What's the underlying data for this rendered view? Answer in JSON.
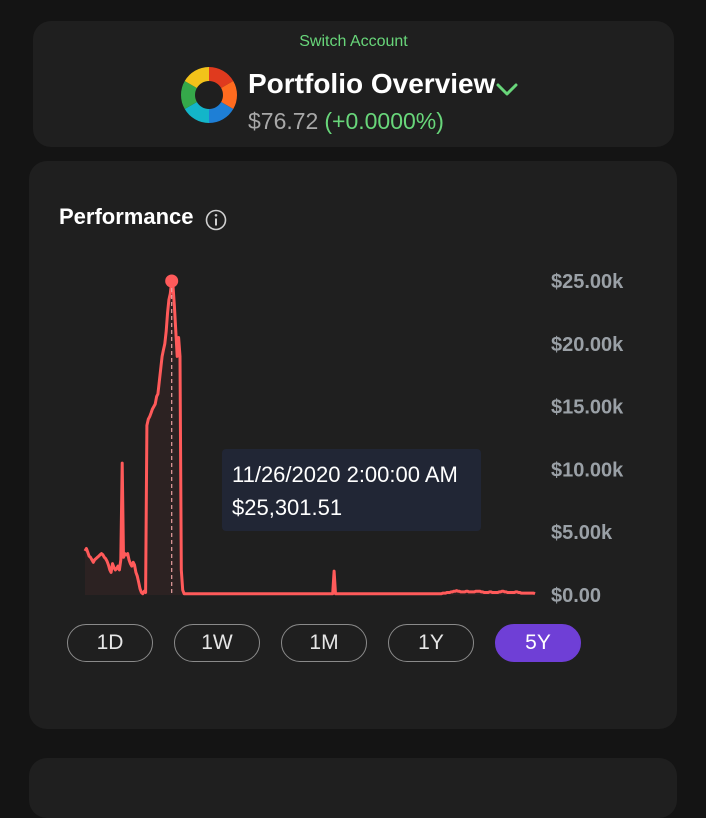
{
  "account": {
    "switch_label": "Switch Account",
    "title": "Portfolio Overview",
    "value": "$76.72",
    "change": "(+0.0000%)"
  },
  "performance": {
    "title": "Performance",
    "tooltip": {
      "date": "11/26/2020 2:00:00 AM",
      "value": "$25,301.51"
    },
    "ranges": [
      {
        "label": "1D",
        "active": false
      },
      {
        "label": "1W",
        "active": false
      },
      {
        "label": "1M",
        "active": false
      },
      {
        "label": "1Y",
        "active": false
      },
      {
        "label": "5Y",
        "active": true
      }
    ]
  },
  "chart_data": {
    "type": "line",
    "ylim": [
      0,
      25000
    ],
    "y_ticks": [
      "$0.00",
      "$5.00k",
      "$10.00k",
      "$15.00k",
      "$20.00k",
      "$25.00k"
    ],
    "highlight_index": 63,
    "series": [
      {
        "color": "#ff5a5a",
        "values": [
          3500,
          3700,
          3400,
          3100,
          3000,
          2800,
          2600,
          2800,
          2900,
          3000,
          3100,
          3200,
          3300,
          3200,
          3000,
          2900,
          2700,
          2400,
          2000,
          1800,
          2500,
          2200,
          2000,
          2100,
          2300,
          2000,
          2800,
          10500,
          3000,
          3300,
          3200,
          3300,
          2800,
          2500,
          2300,
          2600,
          2400,
          1800,
          1500,
          1000,
          500,
          200,
          100,
          300,
          200,
          13500,
          14000,
          14200,
          14500,
          14800,
          15000,
          15200,
          15800,
          16000,
          17000,
          18000,
          19000,
          19500,
          20000,
          21000,
          22500,
          23500,
          24000,
          25000,
          24500,
          23000,
          21000,
          19000,
          20500,
          19000,
          2000,
          400,
          100,
          100,
          100,
          100,
          100,
          100,
          100,
          100,
          100,
          100,
          100,
          100,
          100,
          100,
          100,
          100,
          100,
          100,
          100,
          100,
          100,
          100,
          100,
          100,
          100,
          100,
          100,
          100,
          100,
          100,
          100,
          100,
          100,
          100,
          100,
          100,
          100,
          100,
          100,
          100,
          100,
          100,
          100,
          100,
          100,
          100,
          100,
          100,
          100,
          100,
          100,
          100,
          100,
          100,
          100,
          100,
          100,
          100,
          100,
          100,
          100,
          100,
          100,
          100,
          100,
          100,
          100,
          100,
          100,
          100,
          100,
          100,
          100,
          100,
          100,
          100,
          100,
          100,
          100,
          100,
          100,
          100,
          100,
          100,
          100,
          100,
          100,
          100,
          100,
          100,
          100,
          100,
          100,
          100,
          100,
          100,
          100,
          100,
          100,
          100,
          100,
          100,
          100,
          100,
          100,
          100,
          100,
          100,
          100,
          1900,
          100,
          100,
          100,
          100,
          100,
          100,
          100,
          100,
          100,
          100,
          100,
          100,
          100,
          100,
          100,
          100,
          100,
          100,
          100,
          100,
          100,
          100,
          100,
          100,
          100,
          100,
          100,
          100,
          100,
          100,
          100,
          100,
          100,
          100,
          100,
          100,
          100,
          100,
          100,
          100,
          100,
          100,
          100,
          100,
          100,
          100,
          100,
          100,
          100,
          100,
          100,
          100,
          100,
          100,
          100,
          100,
          100,
          100,
          100,
          100,
          100,
          100,
          100,
          100,
          100,
          100,
          100,
          100,
          100,
          100,
          100,
          100,
          100,
          100,
          100,
          100,
          100,
          100,
          150,
          150,
          150,
          200,
          200,
          200,
          250,
          250,
          300,
          300,
          350,
          300,
          300,
          250,
          250,
          250,
          250,
          300,
          300,
          250,
          250,
          250,
          250,
          250,
          300,
          300,
          300,
          300,
          250,
          250,
          200,
          200,
          200,
          200,
          250,
          250,
          200,
          200,
          200,
          200,
          200,
          250,
          250,
          300,
          300,
          250,
          250,
          200,
          200,
          200,
          200,
          200,
          200,
          250,
          250,
          200,
          200,
          150,
          150,
          150,
          150,
          150,
          150,
          150,
          150,
          150,
          150,
          100
        ]
      }
    ]
  }
}
